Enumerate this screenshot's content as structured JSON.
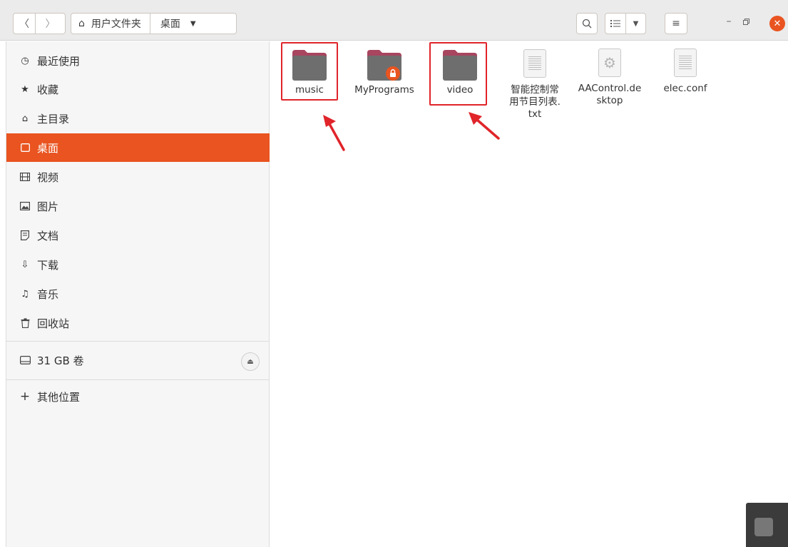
{
  "header": {
    "path_home": "用户文件夹",
    "path_current": "桌面"
  },
  "sidebar": {
    "items": [
      {
        "label": "最近使用",
        "icon": "clock-icon",
        "glyph": "◷"
      },
      {
        "label": "收藏",
        "icon": "star-icon",
        "glyph": "★"
      },
      {
        "label": "主目录",
        "icon": "home-icon",
        "glyph": "⌂"
      },
      {
        "label": "桌面",
        "icon": "desktop-icon",
        "glyph": "▭",
        "active": true
      },
      {
        "label": "视频",
        "icon": "video-icon",
        "glyph": "▤"
      },
      {
        "label": "图片",
        "icon": "picture-icon",
        "glyph": "▣"
      },
      {
        "label": "文档",
        "icon": "document-icon",
        "glyph": "▯"
      },
      {
        "label": "下载",
        "icon": "download-icon",
        "glyph": "⇩"
      },
      {
        "label": "音乐",
        "icon": "music-icon",
        "glyph": "♫"
      },
      {
        "label": "回收站",
        "icon": "trash-icon",
        "glyph": "♲"
      }
    ],
    "volume": {
      "label": "31 GB 卷",
      "icon": "drive-icon"
    },
    "other": {
      "label": "其他位置",
      "icon": "plus-icon",
      "glyph": "+"
    }
  },
  "files": [
    {
      "name": "music",
      "type": "folder"
    },
    {
      "name": "MyPrograms",
      "type": "folder-locked"
    },
    {
      "name": "video",
      "type": "folder"
    },
    {
      "name": "智能控制常用节目列表.txt",
      "type": "text"
    },
    {
      "name": "AAControl.desktop",
      "type": "desktop"
    },
    {
      "name": "elec.conf",
      "type": "text"
    }
  ],
  "colors": {
    "accent": "#e95420",
    "highlight": "#e0242a",
    "folder_body": "#6e6e6e",
    "folder_tab": "#a8455f"
  }
}
